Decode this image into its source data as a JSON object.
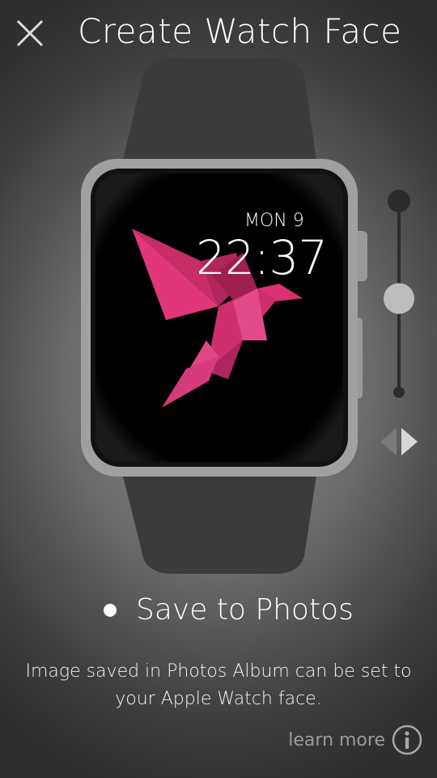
{
  "header": {
    "title": "Create Watch Face",
    "close_icon": "close-icon"
  },
  "watch": {
    "date": "MON 9",
    "time": "22:37",
    "image": "origami-bird-icon",
    "colors": {
      "band": "#3a3a3a",
      "case": "#9c9c9c",
      "screen": "#000000",
      "accent": "#d2326e"
    }
  },
  "controls": {
    "zoom_slider_value": 0.49,
    "arrows_icon": "left-right-arrows-icon"
  },
  "save": {
    "label": "Save to Photos",
    "description": "Image saved in Photos Album can be set to your Apple Watch face."
  },
  "learn_more": {
    "label": "learn more",
    "icon": "info-icon"
  }
}
